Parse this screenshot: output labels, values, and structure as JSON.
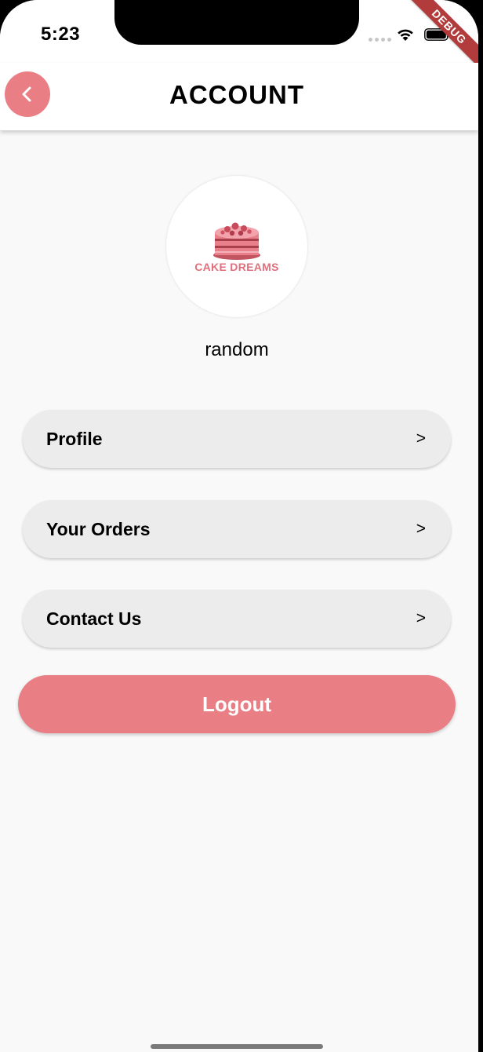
{
  "status_bar": {
    "time": "5:23"
  },
  "debug_banner": "DEBUG",
  "app_bar": {
    "title": "ACCOUNT",
    "back_icon": "chevron-left-icon"
  },
  "profile": {
    "logo_text": "CAKE DREAMS",
    "username": "random"
  },
  "menu": {
    "items": [
      {
        "label": "Profile",
        "arrow": ">"
      },
      {
        "label": "Your Orders",
        "arrow": ">"
      },
      {
        "label": "Contact Us",
        "arrow": ">"
      }
    ]
  },
  "logout": {
    "label": "Logout"
  },
  "colors": {
    "accent": "#e97f85",
    "menu_bg": "#ececec",
    "page_bg": "#f9f9f9"
  }
}
